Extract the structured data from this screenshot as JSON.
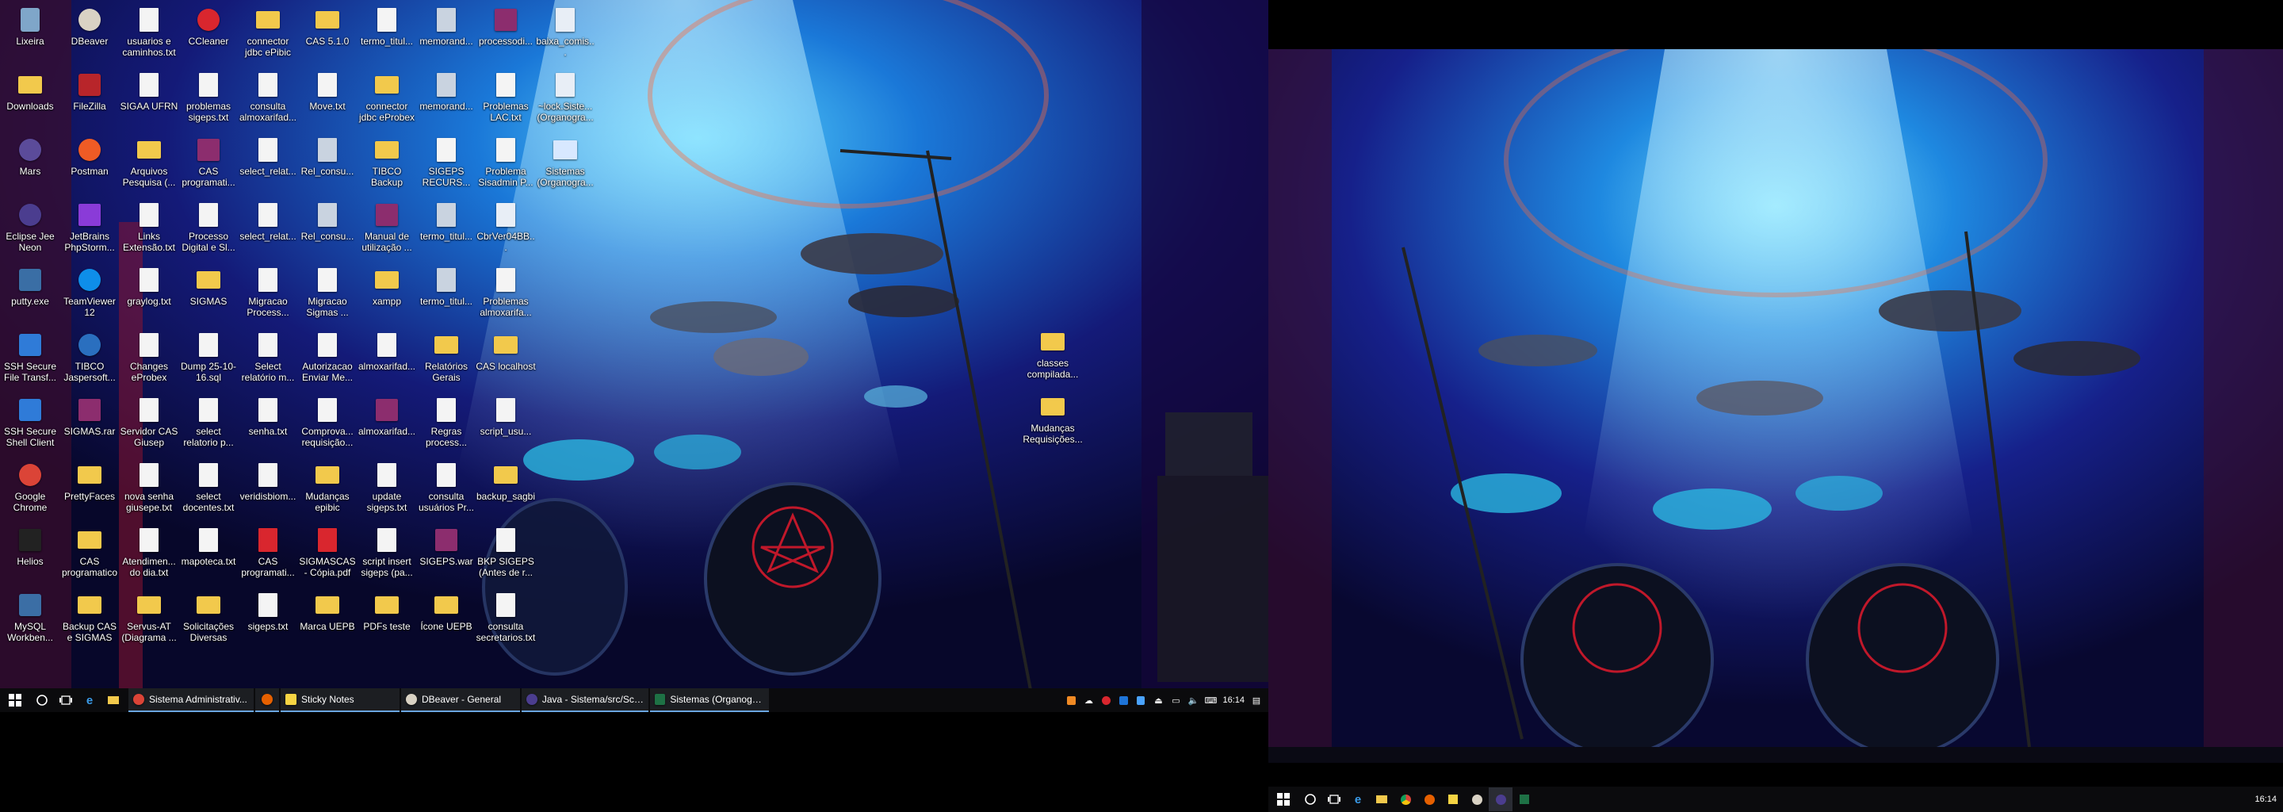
{
  "colors": {
    "accent": "#6aa6e0",
    "taskbar": "#0b0b0d",
    "bg_deep": "#0a0a3a"
  },
  "desktop": {
    "columns": [
      [
        {
          "label": "Lixeira",
          "icon": "recycle-bin-icon"
        },
        {
          "label": "Downloads",
          "icon": "downloads-folder-icon"
        },
        {
          "label": "Mars",
          "icon": "eclipse-mars-icon"
        },
        {
          "label": "Eclipse Jee Neon",
          "icon": "eclipse-neon-icon"
        },
        {
          "label": "putty.exe",
          "icon": "putty-icon"
        },
        {
          "label": "SSH Secure File Transf...",
          "icon": "ssh-file-transfer-icon"
        },
        {
          "label": "SSH Secure Shell Client",
          "icon": "ssh-shell-icon"
        },
        {
          "label": "Google Chrome",
          "icon": "chrome-icon"
        },
        {
          "label": "Helios",
          "icon": "helios-icon"
        },
        {
          "label": "MySQL Workben...",
          "icon": "mysql-workbench-icon"
        }
      ],
      [
        {
          "label": "DBeaver",
          "icon": "dbeaver-icon"
        },
        {
          "label": "FileZilla",
          "icon": "filezilla-icon"
        },
        {
          "label": "Postman",
          "icon": "postman-icon"
        },
        {
          "label": "JetBrains PhpStorm...",
          "icon": "phpstorm-icon"
        },
        {
          "label": "TeamViewer 12",
          "icon": "teamviewer-icon"
        },
        {
          "label": "TIBCO Jaspersoft...",
          "icon": "jaspersoft-icon"
        },
        {
          "label": "SIGMAS.rar",
          "icon": "winrar-archive-icon"
        },
        {
          "label": "PrettyFaces",
          "icon": "folder-icon"
        },
        {
          "label": "CAS programatico",
          "icon": "folder-icon"
        },
        {
          "label": "Backup CAS e SIGMAS",
          "icon": "folder-icon"
        }
      ],
      [
        {
          "label": "usuarios e caminhos.txt",
          "icon": "text-file-icon"
        },
        {
          "label": "SIGAA UFRN",
          "icon": "text-file-icon"
        },
        {
          "label": "Arquivos Pesquisa (...",
          "icon": "folder-icon"
        },
        {
          "label": "Links Extensão.txt",
          "icon": "text-file-icon"
        },
        {
          "label": "graylog.txt",
          "icon": "text-file-icon"
        },
        {
          "label": "Changes eProbex",
          "icon": "text-file-icon"
        },
        {
          "label": "Servidor CAS Giusep",
          "icon": "text-file-icon"
        },
        {
          "label": "nova senha giusepe.txt",
          "icon": "text-file-icon"
        },
        {
          "label": "Atendimen... do dia.txt",
          "icon": "text-file-icon"
        },
        {
          "label": "Servus-AT (Diagrama ...",
          "icon": "folder-icon"
        }
      ],
      [
        {
          "label": "CCleaner",
          "icon": "ccleaner-icon"
        },
        {
          "label": "problemas sigeps.txt",
          "icon": "text-file-icon"
        },
        {
          "label": "CAS programati...",
          "icon": "winrar-archive-icon"
        },
        {
          "label": "Processo Digital e Sl...",
          "icon": "text-file-icon"
        },
        {
          "label": "SIGMAS",
          "icon": "folder-icon"
        },
        {
          "label": "Dump 25-10-16.sql",
          "icon": "text-file-icon"
        },
        {
          "label": "select relatorio p...",
          "icon": "text-file-icon"
        },
        {
          "label": "select docentes.txt",
          "icon": "text-file-icon"
        },
        {
          "label": "mapoteca.txt",
          "icon": "text-file-icon"
        },
        {
          "label": "Solicitações Diversas",
          "icon": "folder-icon"
        }
      ],
      [
        {
          "label": "connector jdbc ePibic",
          "icon": "folder-icon"
        },
        {
          "label": "consulta almoxarifad...",
          "icon": "text-file-icon"
        },
        {
          "label": "select_relat...",
          "icon": "text-file-icon"
        },
        {
          "label": "select_relat...",
          "icon": "text-file-icon"
        },
        {
          "label": "Migracao Process...",
          "icon": "text-file-icon"
        },
        {
          "label": "Select relatório m...",
          "icon": "text-file-icon"
        },
        {
          "label": "senha.txt",
          "icon": "text-file-icon"
        },
        {
          "label": "veridisbiom...",
          "icon": "java-icon"
        },
        {
          "label": "CAS programati...",
          "icon": "pdf-icon"
        },
        {
          "label": "sigeps.txt",
          "icon": "text-file-icon"
        }
      ],
      [
        {
          "label": "CAS 5.1.0",
          "icon": "folder-icon"
        },
        {
          "label": "Move.txt",
          "icon": "text-file-icon"
        },
        {
          "label": "Rel_consu...",
          "icon": "shortcut-icon"
        },
        {
          "label": "Rel_consu...",
          "icon": "shortcut-icon"
        },
        {
          "label": "Migracao Sigmas ...",
          "icon": "text-file-icon"
        },
        {
          "label": "Autorizacao Enviar Me...",
          "icon": "text-file-icon"
        },
        {
          "label": "Comprova... requisição...",
          "icon": "text-file-icon"
        },
        {
          "label": "Mudanças epibic",
          "icon": "folder-icon"
        },
        {
          "label": "SIGMASCAS - Cópia.pdf",
          "icon": "pdf-icon"
        },
        {
          "label": "Marca UEPB",
          "icon": "folder-icon"
        }
      ],
      [
        {
          "label": "termo_titul...",
          "icon": "text-file-icon"
        },
        {
          "label": "connector jdbc eProbex",
          "icon": "folder-icon"
        },
        {
          "label": "TIBCO Backup",
          "icon": "folder-icon"
        },
        {
          "label": "Manual de utilização ...",
          "icon": "winrar-archive-icon"
        },
        {
          "label": "xampp",
          "icon": "folder-icon"
        },
        {
          "label": "almoxarifad...",
          "icon": "text-file-icon"
        },
        {
          "label": "almoxarifad...",
          "icon": "winrar-archive-icon"
        },
        {
          "label": "update sigeps.txt",
          "icon": "text-file-icon"
        },
        {
          "label": "script insert sigeps (pa...",
          "icon": "text-file-icon"
        },
        {
          "label": "PDFs teste",
          "icon": "folder-icon"
        }
      ],
      [
        {
          "label": "memorand...",
          "icon": "shortcut-icon"
        },
        {
          "label": "memorand...",
          "icon": "shortcut-icon"
        },
        {
          "label": "SIGEPS RECURS...",
          "icon": "text-file-icon"
        },
        {
          "label": "termo_titul...",
          "icon": "shortcut-icon"
        },
        {
          "label": "termo_titul...",
          "icon": "shortcut-icon"
        },
        {
          "label": "Relatórios Gerais",
          "icon": "folder-icon"
        },
        {
          "label": "Regras process...",
          "icon": "text-file-icon"
        },
        {
          "label": "consulta usuários Pr...",
          "icon": "text-file-icon"
        },
        {
          "label": "SIGEPS.war",
          "icon": "winrar-archive-icon"
        },
        {
          "label": "Ícone UEPB",
          "icon": "folder-icon"
        }
      ],
      [
        {
          "label": "processodi...",
          "icon": "winrar-archive-icon"
        },
        {
          "label": "Problemas LAC.txt",
          "icon": "text-file-icon"
        },
        {
          "label": "Problema Sisadmin P...",
          "icon": "text-file-icon"
        },
        {
          "label": "CbrVer04BB...",
          "icon": "generic-file-icon"
        },
        {
          "label": "Problemas almoxarifa...",
          "icon": "text-file-icon"
        },
        {
          "label": "CAS localhost",
          "icon": "folder-icon"
        },
        {
          "label": "script_usu...",
          "icon": "text-file-icon"
        },
        {
          "label": "backup_sagbi",
          "icon": "folder-icon"
        },
        {
          "label": "BKP SIGEPS (Antes de r...",
          "icon": "text-file-icon"
        },
        {
          "label": "consulta secretarios.txt",
          "icon": "text-file-icon"
        }
      ],
      [
        {
          "label": "baixa_comis...",
          "icon": "generic-file-icon"
        },
        {
          "label": "~lock.Siste... (Organogra...",
          "icon": "generic-file-icon"
        },
        {
          "label": "Sistemas (Organogra...",
          "icon": "window-icon"
        }
      ]
    ],
    "right_icons": [
      {
        "label": "classes compilada...",
        "icon": "folder-icon"
      },
      {
        "label": "Mudanças Requisições...",
        "icon": "folder-icon"
      }
    ]
  },
  "taskbar1": {
    "apps": [
      {
        "label": "Sistema Administrativ...",
        "icon": "chrome-icon"
      },
      {
        "label": "",
        "icon": "firefox-icon"
      },
      {
        "label": "Sticky Notes",
        "icon": "sticky-notes-icon"
      },
      {
        "label": "DBeaver - General",
        "icon": "dbeaver-icon"
      },
      {
        "label": "Java - Sistema/src/Scr...",
        "icon": "eclipse-icon"
      },
      {
        "label": "Sistemas (Organogra...",
        "icon": "excel-icon"
      }
    ],
    "clock": "16:14"
  },
  "taskbar2": {
    "clock": "16:14"
  }
}
